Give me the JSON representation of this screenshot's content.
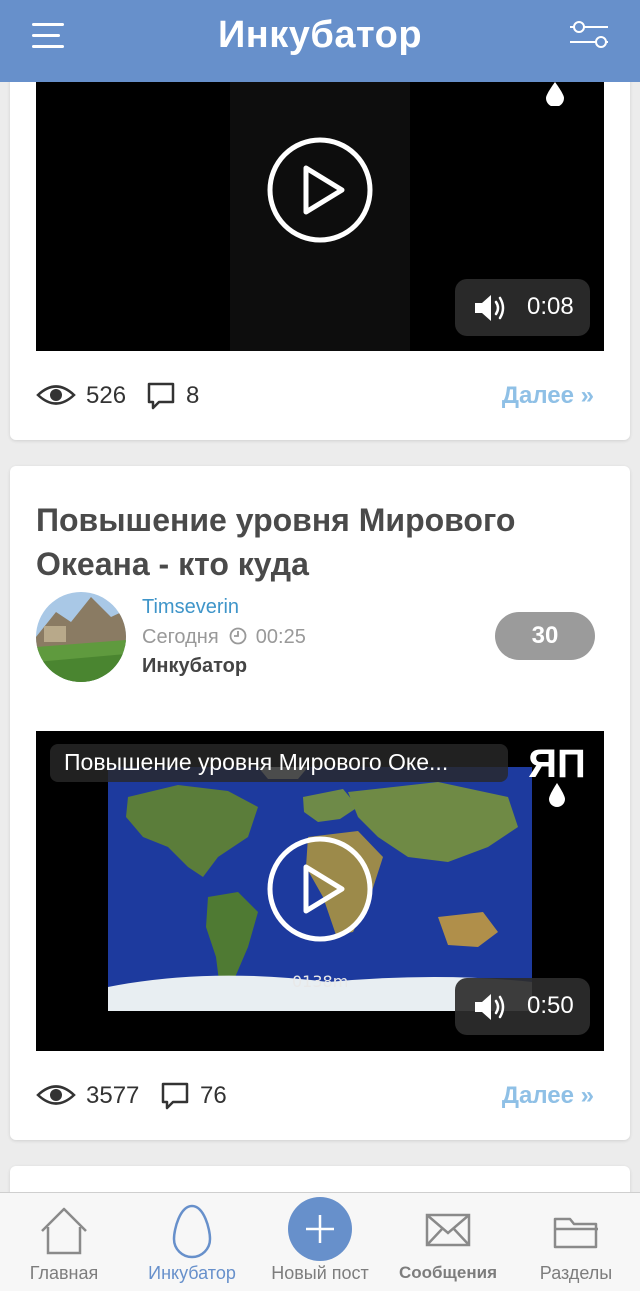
{
  "header": {
    "title": "Инкубатор",
    "menu_icon": "hamburger-menu-icon",
    "filter_icon": "filter-settings-icon"
  },
  "posts": [
    {
      "video": {
        "duration": "0:08"
      },
      "stats": {
        "views": "526",
        "comments": "8"
      },
      "more_label": "Далее »"
    },
    {
      "title": "Повышение уровня Мирового Океана - кто куда",
      "author": "Timseverin",
      "date_text": "Сегодня",
      "time": "00:25",
      "section": "Инкубатор",
      "rating": "30",
      "video": {
        "title": "Повышение уровня Мирового Оке...",
        "duration": "0:50",
        "caption": "0138m",
        "logo": "ЯП"
      },
      "stats": {
        "views": "3577",
        "comments": "76"
      },
      "more_label": "Далее »"
    }
  ],
  "bottom_nav": {
    "items": [
      {
        "label": "Главная",
        "icon": "home-icon"
      },
      {
        "label": "Инкубатор",
        "icon": "egg-icon",
        "active": true
      },
      {
        "label": "Новый пост",
        "icon": "plus-icon"
      },
      {
        "label": "Сообщения",
        "icon": "envelope-icon"
      },
      {
        "label": "Разделы",
        "icon": "folder-icon"
      }
    ]
  },
  "colors": {
    "header": "#6790cb",
    "link": "#3f95c9",
    "more": "#8fc0e6",
    "rating_badge": "#9b9b9b",
    "active_nav": "#6790cb"
  }
}
